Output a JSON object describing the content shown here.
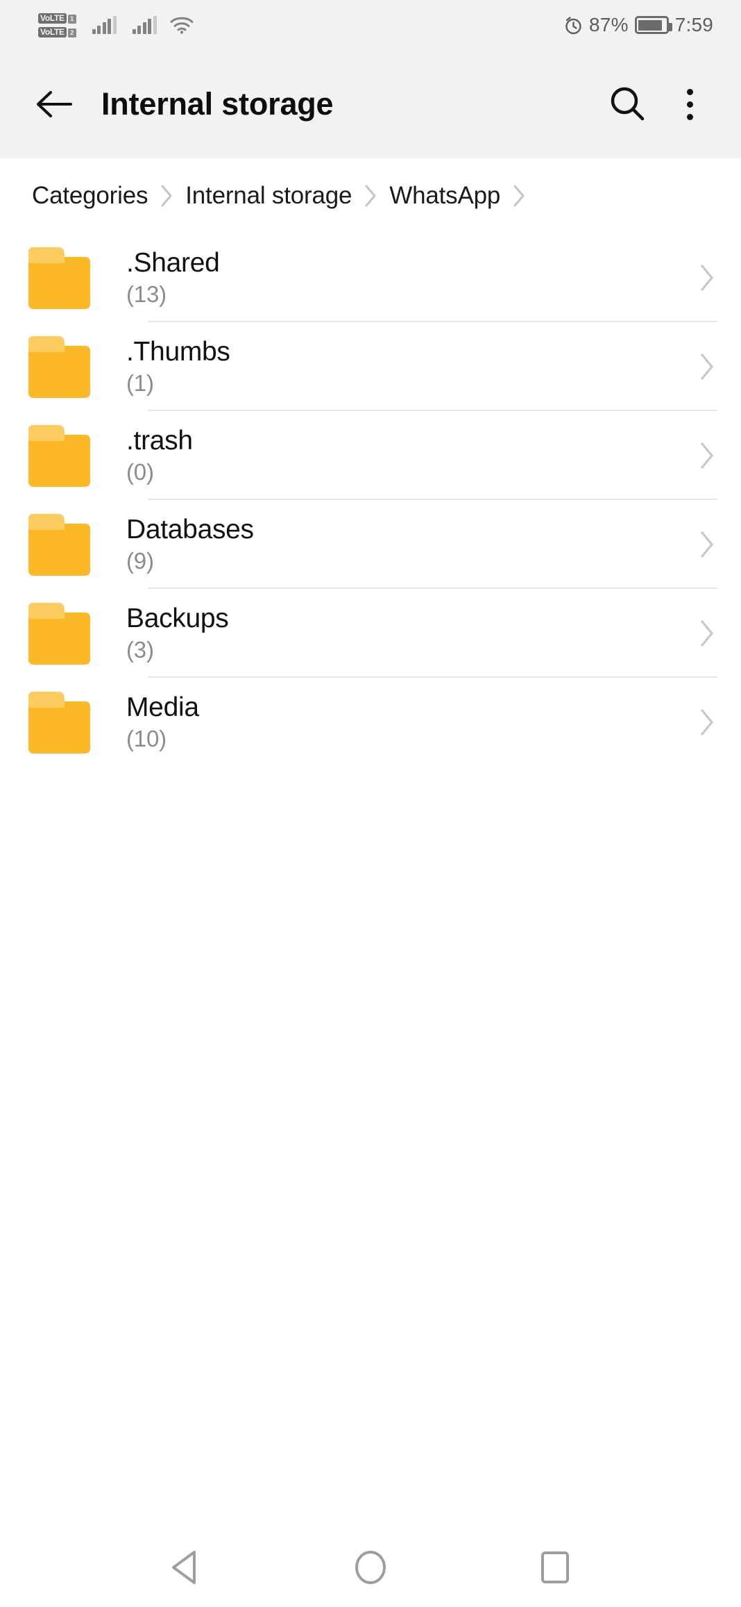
{
  "status_bar": {
    "volte_1_label": "VoLTE",
    "volte_1_sim": "1",
    "volte_2_label": "VoLTE",
    "volte_2_sim": "2",
    "battery_percent": "87%",
    "time": "7:59",
    "icons": [
      "volte-icon",
      "signal-bars-icon",
      "signal-bars-icon",
      "wifi-icon",
      "alarm-icon",
      "battery-icon"
    ]
  },
  "app_bar": {
    "title": "Internal storage",
    "back_icon": "arrow-left-icon",
    "search_icon": "search-icon",
    "menu_icon": "overflow-menu-icon"
  },
  "breadcrumb": {
    "items": [
      {
        "label": "Categories"
      },
      {
        "label": "Internal storage"
      },
      {
        "label": "WhatsApp"
      }
    ],
    "separator_icon": "chevron-right-icon",
    "trailing_separator": true
  },
  "file_list": {
    "chevron_icon": "chevron-right-icon",
    "folder_icon": "folder-icon",
    "items": [
      {
        "name": ".Shared",
        "count": "(13)"
      },
      {
        "name": ".Thumbs",
        "count": "(1)"
      },
      {
        "name": ".trash",
        "count": "(0)"
      },
      {
        "name": "Databases",
        "count": "(9)"
      },
      {
        "name": "Backups",
        "count": "(3)"
      },
      {
        "name": "Media",
        "count": "(10)"
      }
    ]
  },
  "nav_bar": {
    "back_icon": "nav-back-triangle-icon",
    "home_icon": "nav-home-circle-icon",
    "recents_icon": "nav-recents-square-icon"
  },
  "colors": {
    "folder_body": "#fdb827",
    "folder_tab": "#fccd5f",
    "appbar_bg": "#f2f2f2",
    "divider": "#e6e6e6",
    "secondary_text": "#8c8c8c"
  }
}
